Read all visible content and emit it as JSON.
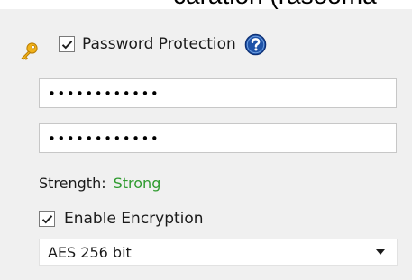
{
  "partial_heading": "caration (rasooma",
  "password_protection": {
    "checked": true,
    "label": "Password Protection"
  },
  "password_field": {
    "masked_value": "••••••••••••"
  },
  "confirm_password_field": {
    "masked_value": "••••••••••••"
  },
  "strength": {
    "label": "Strength:",
    "value": "Strong",
    "value_color": "#2f9b2f"
  },
  "encryption": {
    "checked": true,
    "label": "Enable Encryption"
  },
  "encryption_method": {
    "selected": "AES 256 bit"
  },
  "icons": {
    "key": "key-icon",
    "help": "help-icon",
    "dropdown": "chevron-down-icon",
    "check": "check-icon"
  }
}
